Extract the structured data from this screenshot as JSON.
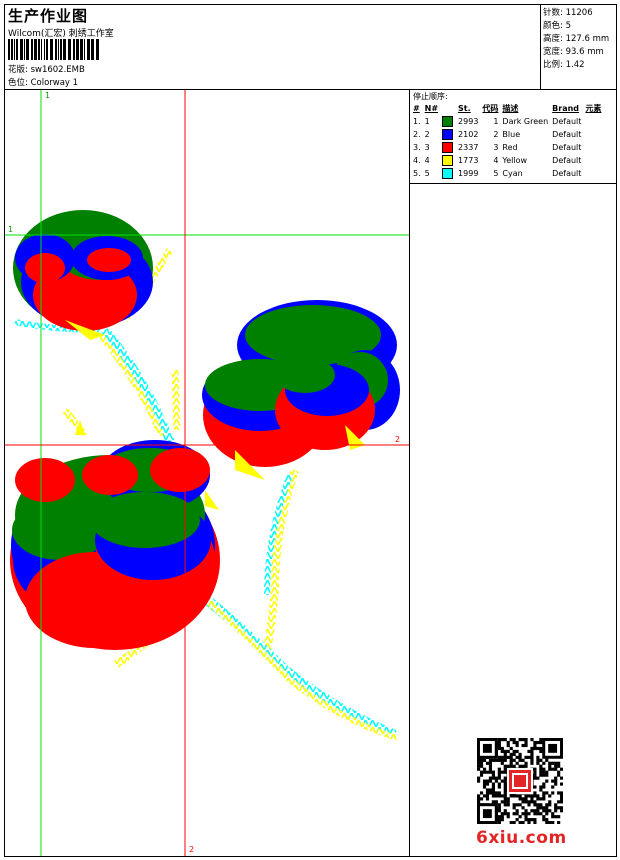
{
  "header": {
    "title": "生产作业图",
    "company": "Wilcom(汇宏) 刺绣工作室",
    "design_label": "花版:",
    "design_value": "sw1602.EMB",
    "colorway_label": "色位:",
    "colorway_value": "Colorway 1"
  },
  "stats": {
    "stitches_label": "针数:",
    "stitches_value": "11206",
    "colors_label": "颜色:",
    "colors_value": "5",
    "height_label": "高度:",
    "height_value": "127.6 mm",
    "width_label": "宽度:",
    "width_value": "93.6 mm",
    "ratio_label": "比例:",
    "ratio_value": "1.42"
  },
  "stop_sequence": {
    "label": "停止顺序:",
    "columns": [
      "#",
      "N#",
      "St.",
      "代码",
      "描述",
      "Brand",
      "元素"
    ],
    "rows": [
      {
        "idx": "1.",
        "n": "1",
        "color": "#008000",
        "st": "2993",
        "code": "1",
        "desc": "Dark Green",
        "brand": "Default"
      },
      {
        "idx": "2.",
        "n": "2",
        "color": "#0000ff",
        "st": "2102",
        "code": "2",
        "desc": "Blue",
        "brand": "Default"
      },
      {
        "idx": "3.",
        "n": "3",
        "color": "#ff0000",
        "st": "2337",
        "code": "3",
        "desc": "Red",
        "brand": "Default"
      },
      {
        "idx": "4.",
        "n": "4",
        "color": "#ffff00",
        "st": "1773",
        "code": "4",
        "desc": "Yellow",
        "brand": "Default"
      },
      {
        "idx": "5.",
        "n": "5",
        "color": "#00ffff",
        "st": "1999",
        "code": "5",
        "desc": "Cyan",
        "brand": "Default"
      }
    ]
  },
  "canvas": {
    "guide_green_label_top": "1",
    "guide_green_label_left": "1",
    "guide_red_label_right": "2",
    "guide_red_label_bottom": "2"
  },
  "watermark": {
    "logo": "6xiu.com"
  },
  "colors": {
    "green": "#008000",
    "blue": "#0000ff",
    "red": "#ff0000",
    "yellow": "#ffff00",
    "cyan": "#00ffff",
    "guide_green": "#00e000",
    "guide_red": "#ff0000"
  },
  "icons": {
    "barcode": "barcode-icon",
    "qr": "qr-code-icon"
  }
}
